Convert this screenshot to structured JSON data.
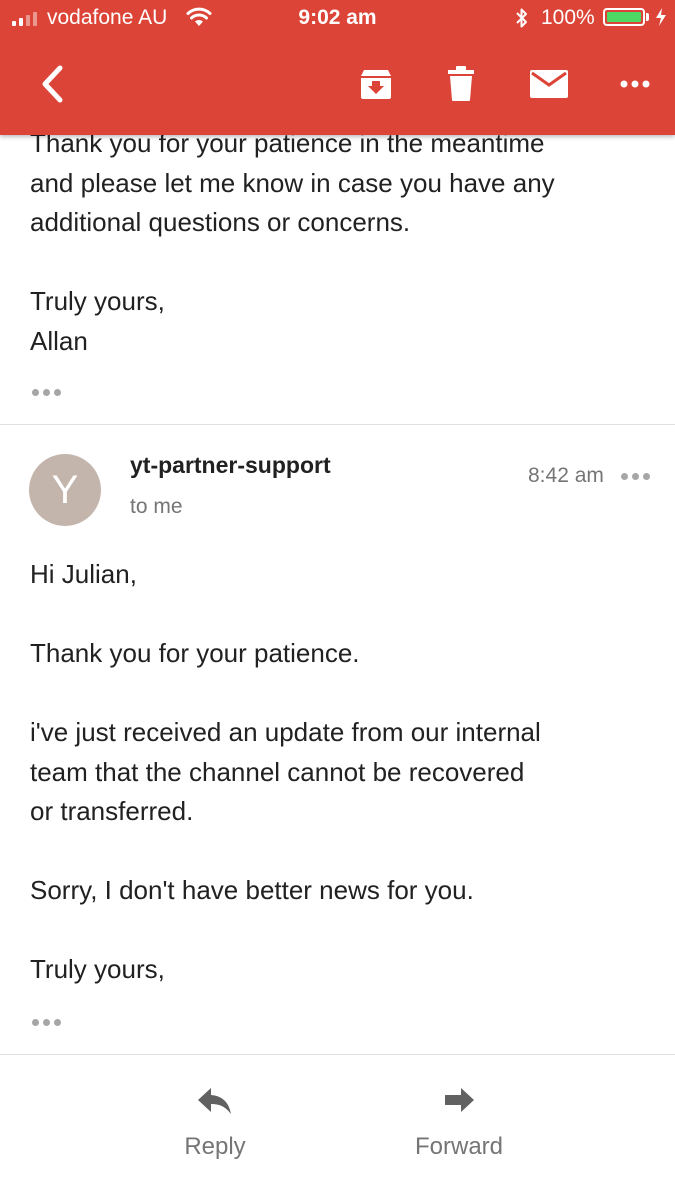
{
  "status_bar": {
    "carrier": "vodafone AU",
    "time": "9:02 am",
    "battery_percent": "100%",
    "signal_bars": 2
  },
  "toolbar": {
    "icons": [
      "back-arrow-icon",
      "archive-icon",
      "trash-icon",
      "mail-icon",
      "more-icon"
    ]
  },
  "previous_message": {
    "lines": [
      "Thank you for your patience in the meantime",
      "and please let me know in case you have any",
      "additional questions or concerns."
    ],
    "signoff": "Truly yours,",
    "signature": "Allan"
  },
  "message": {
    "avatar_letter": "Y",
    "sender": "yt-partner-support",
    "recipient": "to me",
    "time": "8:42 am",
    "greeting": "Hi Julian,",
    "paragraph1": "Thank you for your patience.",
    "paragraph2_lines": [
      "i've just received an update from our internal",
      "team that the channel cannot be recovered",
      "or transferred."
    ],
    "paragraph3": "Sorry, I don't have better news for you.",
    "signoff": "Truly yours,"
  },
  "actions": {
    "reply_label": "Reply",
    "forward_label": "Forward"
  },
  "colors": {
    "header": "#db4437",
    "avatar": "#c4b5ac",
    "battery": "#4cd964"
  }
}
